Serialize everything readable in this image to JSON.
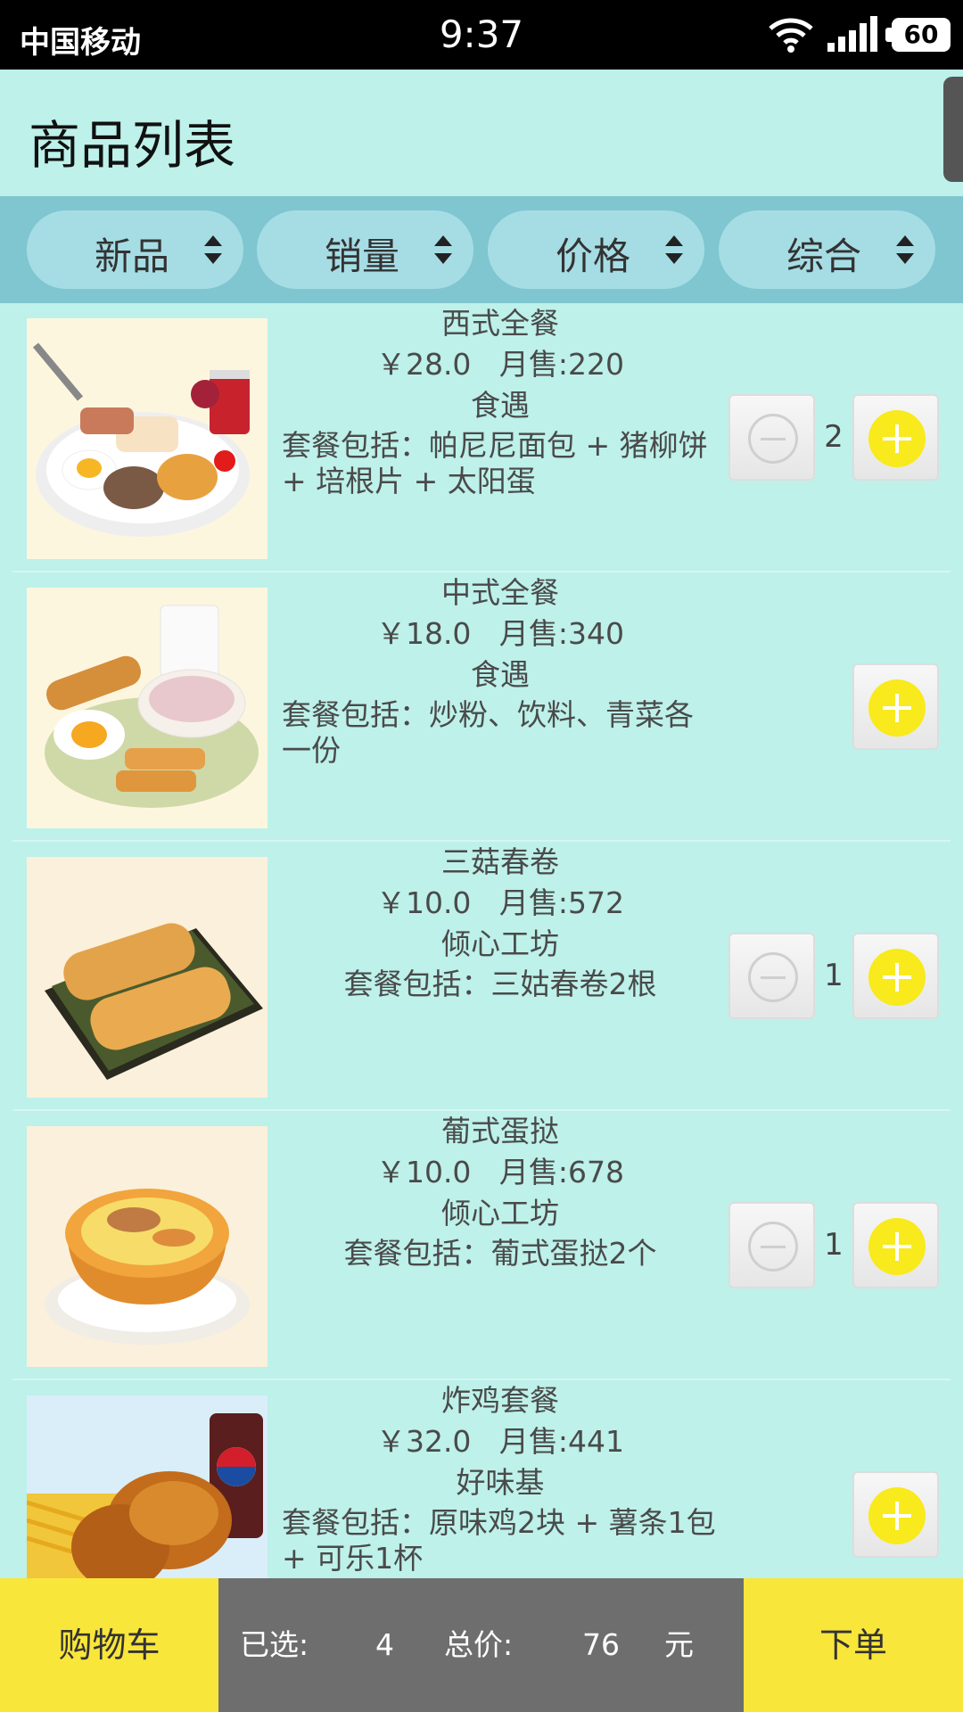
{
  "status_bar": {
    "carrier": "中国移动",
    "time": "9:37",
    "battery": "60"
  },
  "header": {
    "title": "商品列表"
  },
  "sort_options": [
    {
      "label": "新品"
    },
    {
      "label": "销量"
    },
    {
      "label": "价格"
    },
    {
      "label": "综合"
    }
  ],
  "products": [
    {
      "name": "西式全餐",
      "price": "￥28.0",
      "sales": "月售:220",
      "brand": "食遇",
      "desc": "套餐包括：帕尼尼面包 + 猪柳饼 + 培根片 + 太阳蛋",
      "quantity": "2",
      "image": "breakfast-platter"
    },
    {
      "name": "中式全餐",
      "price": "￥18.0",
      "sales": "月售:340",
      "brand": "食遇",
      "desc": "套餐包括：炒粉、饮料、青菜各一份",
      "quantity": "",
      "image": "chinese-breakfast"
    },
    {
      "name": "三菇春卷",
      "price": "￥10.0",
      "sales": "月售:572",
      "brand": "倾心工坊",
      "desc": "套餐包括：三姑春卷2根",
      "quantity": "1",
      "image": "spring-rolls"
    },
    {
      "name": "葡式蛋挞",
      "price": "￥10.0",
      "sales": "月售:678",
      "brand": "倾心工坊",
      "desc": "套餐包括：葡式蛋挞2个",
      "quantity": "1",
      "image": "egg-tart"
    },
    {
      "name": "炸鸡套餐",
      "price": "￥32.0",
      "sales": "月售:441",
      "brand": "好味基",
      "desc": "套餐包括：原味鸡2块 + 薯条1包 + 可乐1杯",
      "quantity": "",
      "image": "fried-chicken-combo"
    }
  ],
  "bottom_bar": {
    "cart_label": "购物车",
    "selected_label": "已选:",
    "selected_count": "4",
    "total_label": "总价:",
    "total_value": "76",
    "currency": "元",
    "order_label": "下单"
  },
  "colors": {
    "background": "#bdf1ea",
    "sort_bar": "#7fc6d0",
    "accent_yellow": "#f9e63a",
    "summary_gray": "#6e6e6e"
  }
}
